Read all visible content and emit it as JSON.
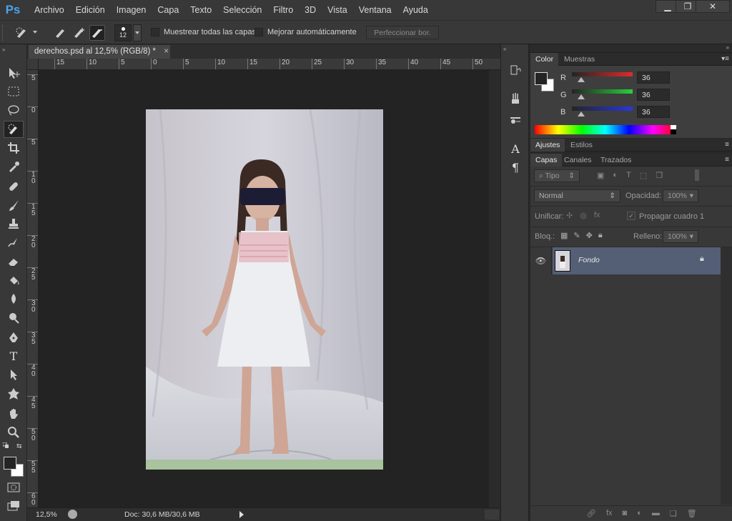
{
  "app": {
    "logo": "Ps"
  },
  "menu": [
    "Archivo",
    "Edición",
    "Imagen",
    "Capa",
    "Texto",
    "Selección",
    "Filtro",
    "3D",
    "Vista",
    "Ventana",
    "Ayuda"
  ],
  "window_controls": {
    "minimize": "▁",
    "restore": "❐",
    "close": "✕"
  },
  "options": {
    "brush_size": "12",
    "sample_all_layers": "Muestrear todas las capas",
    "auto_enhance": "Mejorar automáticamente",
    "refine_edge": "Perfeccionar bor."
  },
  "document": {
    "tab_title": "derechos.psd al 12,5% (RGB/8) *",
    "close": "×",
    "ruler_top": [
      "15",
      "10",
      "5",
      "0",
      "5",
      "10",
      "15",
      "20",
      "25",
      "30",
      "35",
      "40",
      "45",
      "50"
    ],
    "ruler_left": [
      "5",
      "0",
      "5",
      "1 0",
      "1 5",
      "2 0",
      "2 5",
      "3 0",
      "3 5",
      "4 0",
      "4 5",
      "5 0",
      "5 5",
      "6 0"
    ]
  },
  "status": {
    "zoom": "12,5%",
    "doc": "Doc: 30,6 MB/30,6 MB"
  },
  "color_panel": {
    "tabs": [
      "Color",
      "Muestras"
    ],
    "r_label": "R",
    "g_label": "G",
    "b_label": "B",
    "r": "36",
    "g": "36",
    "b": "36"
  },
  "adjust_panel": {
    "tabs": [
      "Ajustes",
      "Estilos"
    ]
  },
  "layers_panel": {
    "tabs": [
      "Capas",
      "Canales",
      "Trazados"
    ],
    "filter_kind": "Tipo",
    "blend_mode": "Normal",
    "opacity_label": "Opacidad:",
    "opacity": "100%",
    "unify_label": "Unificar:",
    "propagate": "Propagar cuadro 1",
    "lock_label": "Bloq.:",
    "fill_label": "Relleno:",
    "fill": "100%",
    "layers": [
      {
        "name": "Fondo"
      }
    ]
  },
  "colors": {
    "accent": "#4aa3f0",
    "selected_layer": "#545f75"
  }
}
